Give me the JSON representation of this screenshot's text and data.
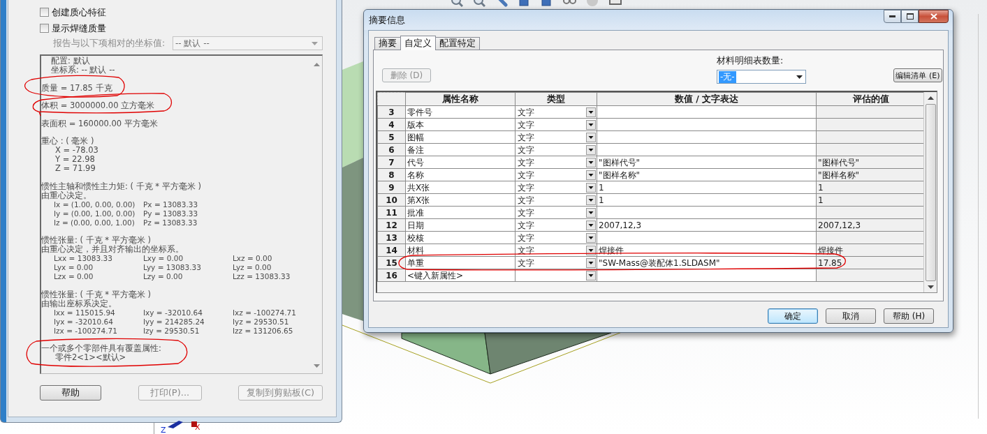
{
  "mass_properties_panel": {
    "checkboxes": [
      {
        "label": "创建质心特征",
        "checked": false
      },
      {
        "label": "显示焊缝质量",
        "checked": false
      }
    ],
    "coordinate_label": "报告与以下项相对的坐标值:",
    "coordinate_dropdown": {
      "value": "-- 默认 --",
      "disabled": true
    },
    "report_sections": [
      [
        {
          "kind": "sub",
          "text": "配置:  默认"
        },
        {
          "kind": "sub",
          "text": "坐标系:  -- 默认 --"
        }
      ],
      [
        {
          "kind": "line",
          "text": "质量 = 17.85 千克"
        }
      ],
      [
        {
          "kind": "line",
          "text": "体积 = 3000000.00  立方毫米"
        }
      ],
      [
        {
          "kind": "line",
          "text": "表面积 = 160000.00  平方毫米"
        }
      ],
      [
        {
          "kind": "line",
          "text": "重心 : ( 毫米 )"
        },
        {
          "kind": "item",
          "text": "X = -78.03"
        },
        {
          "kind": "item",
          "text": "Y = 22.98"
        },
        {
          "kind": "item",
          "text": "Z = 71.99"
        }
      ],
      [
        {
          "kind": "line",
          "text": "惯性主轴和惯性主力矩: ( 千克 * 平方毫米 )"
        },
        {
          "kind": "line",
          "text": "由重心决定。"
        },
        {
          "kind": "row",
          "cells": [
            "Ix = (1.00, 0.00, 0.00)",
            "Px = 13083.33"
          ]
        },
        {
          "kind": "row",
          "cells": [
            "Iy = (0.00, 1.00, 0.00)",
            "Py = 13083.33"
          ]
        },
        {
          "kind": "row",
          "cells": [
            "Iz = (0.00, 0.00, 1.00)",
            "Pz = 13083.33"
          ]
        }
      ],
      [
        {
          "kind": "line",
          "text": "惯性张量: ( 千克 * 平方毫米 )"
        },
        {
          "kind": "line",
          "text": "由重心决定，并且对齐输出的坐标系。"
        },
        {
          "kind": "row",
          "cells": [
            "Lxx = 13083.33",
            "Lxy = 0.00",
            "Lxz = 0.00"
          ]
        },
        {
          "kind": "row",
          "cells": [
            "Lyx = 0.00",
            "Lyy = 13083.33",
            "Lyz = 0.00"
          ]
        },
        {
          "kind": "row",
          "cells": [
            "Lzx = 0.00",
            "Lzy = 0.00",
            "Lzz = 13083.33"
          ]
        }
      ],
      [
        {
          "kind": "line",
          "text": "惯性张量: ( 千克 * 平方毫米 )"
        },
        {
          "kind": "line",
          "text": "由输出座标系决定。"
        },
        {
          "kind": "row",
          "cells": [
            "Ixx = 115015.94",
            "Ixy = -32010.64",
            "Ixz = -100274.71"
          ]
        },
        {
          "kind": "row",
          "cells": [
            "Iyx = -32010.64",
            "Iyy = 214285.24",
            "Iyz = 29530.51"
          ]
        },
        {
          "kind": "row",
          "cells": [
            "Izx = -100274.71",
            "Izy = 29530.51",
            "Izz = 131206.65"
          ]
        }
      ],
      [
        {
          "kind": "line",
          "text": "一个或多个零部件具有覆盖属性:"
        },
        {
          "kind": "item",
          "text": "零件2<1><默认>"
        }
      ]
    ],
    "buttons": [
      {
        "label": "帮助",
        "disabled": false
      },
      {
        "label": "打印(P)...",
        "disabled": true
      },
      {
        "label": "复制到剪贴板(C)",
        "disabled": true
      }
    ]
  },
  "summary_dialog": {
    "title": "摘要信息",
    "tabs": [
      {
        "label": "摘要",
        "selected": false
      },
      {
        "label": "自定义",
        "selected": true
      },
      {
        "label": "配置特定",
        "selected": false
      }
    ],
    "delete_button": {
      "label": "删除 (D)",
      "disabled": true
    },
    "bom_quantity_label": "材料明细表数量:",
    "bom_quantity_dropdown": {
      "value": "-无-",
      "highlighted": true
    },
    "edit_list_button": "编辑清单 (E)",
    "table": {
      "columns": [
        "属性名称",
        "类型",
        "数值 / 文字表达",
        "评估的值"
      ],
      "rows": [
        {
          "number": "3",
          "name": "零件号",
          "type": "文字"
        },
        {
          "number": "4",
          "name": "版本",
          "type": "文字"
        },
        {
          "number": "5",
          "name": "图幅",
          "type": "文字"
        },
        {
          "number": "6",
          "name": "备注",
          "type": "文字"
        },
        {
          "number": "7",
          "name": "代号",
          "type": "文字",
          "value": "\"图样代号\"",
          "evaluated": "\"图样代号\""
        },
        {
          "number": "8",
          "name": "名称",
          "type": "文字",
          "value": "\"图样名称\"",
          "evaluated": "\"图样名称\""
        },
        {
          "number": "9",
          "name": "共X张",
          "type": "文字",
          "value": "1",
          "evaluated": "1"
        },
        {
          "number": "10",
          "name": "第X张",
          "type": "文字",
          "value": "1",
          "evaluated": "1"
        },
        {
          "number": "11",
          "name": "批准",
          "type": "文字"
        },
        {
          "number": "12",
          "name": "日期",
          "type": "文字",
          "value": "2007,12,3",
          "evaluated": "2007,12,3"
        },
        {
          "number": "13",
          "name": "校核",
          "type": "文字"
        },
        {
          "number": "14",
          "name": "材料",
          "type": "文字",
          "value": "焊接件",
          "evaluated": "焊接件"
        },
        {
          "number": "15",
          "name": "单重",
          "type": "文字",
          "value": "\"SW-Mass@装配体1.SLDASM\"",
          "evaluated": "17.85"
        },
        {
          "number": "16",
          "name": "<键入新属性>"
        }
      ]
    },
    "buttons": [
      {
        "label": "确定",
        "default": true
      },
      {
        "label": "取消",
        "default": false
      },
      {
        "label": "帮助 (H)",
        "default": false
      }
    ]
  },
  "axis_triad": {
    "labels": [
      "Z",
      "X"
    ]
  }
}
